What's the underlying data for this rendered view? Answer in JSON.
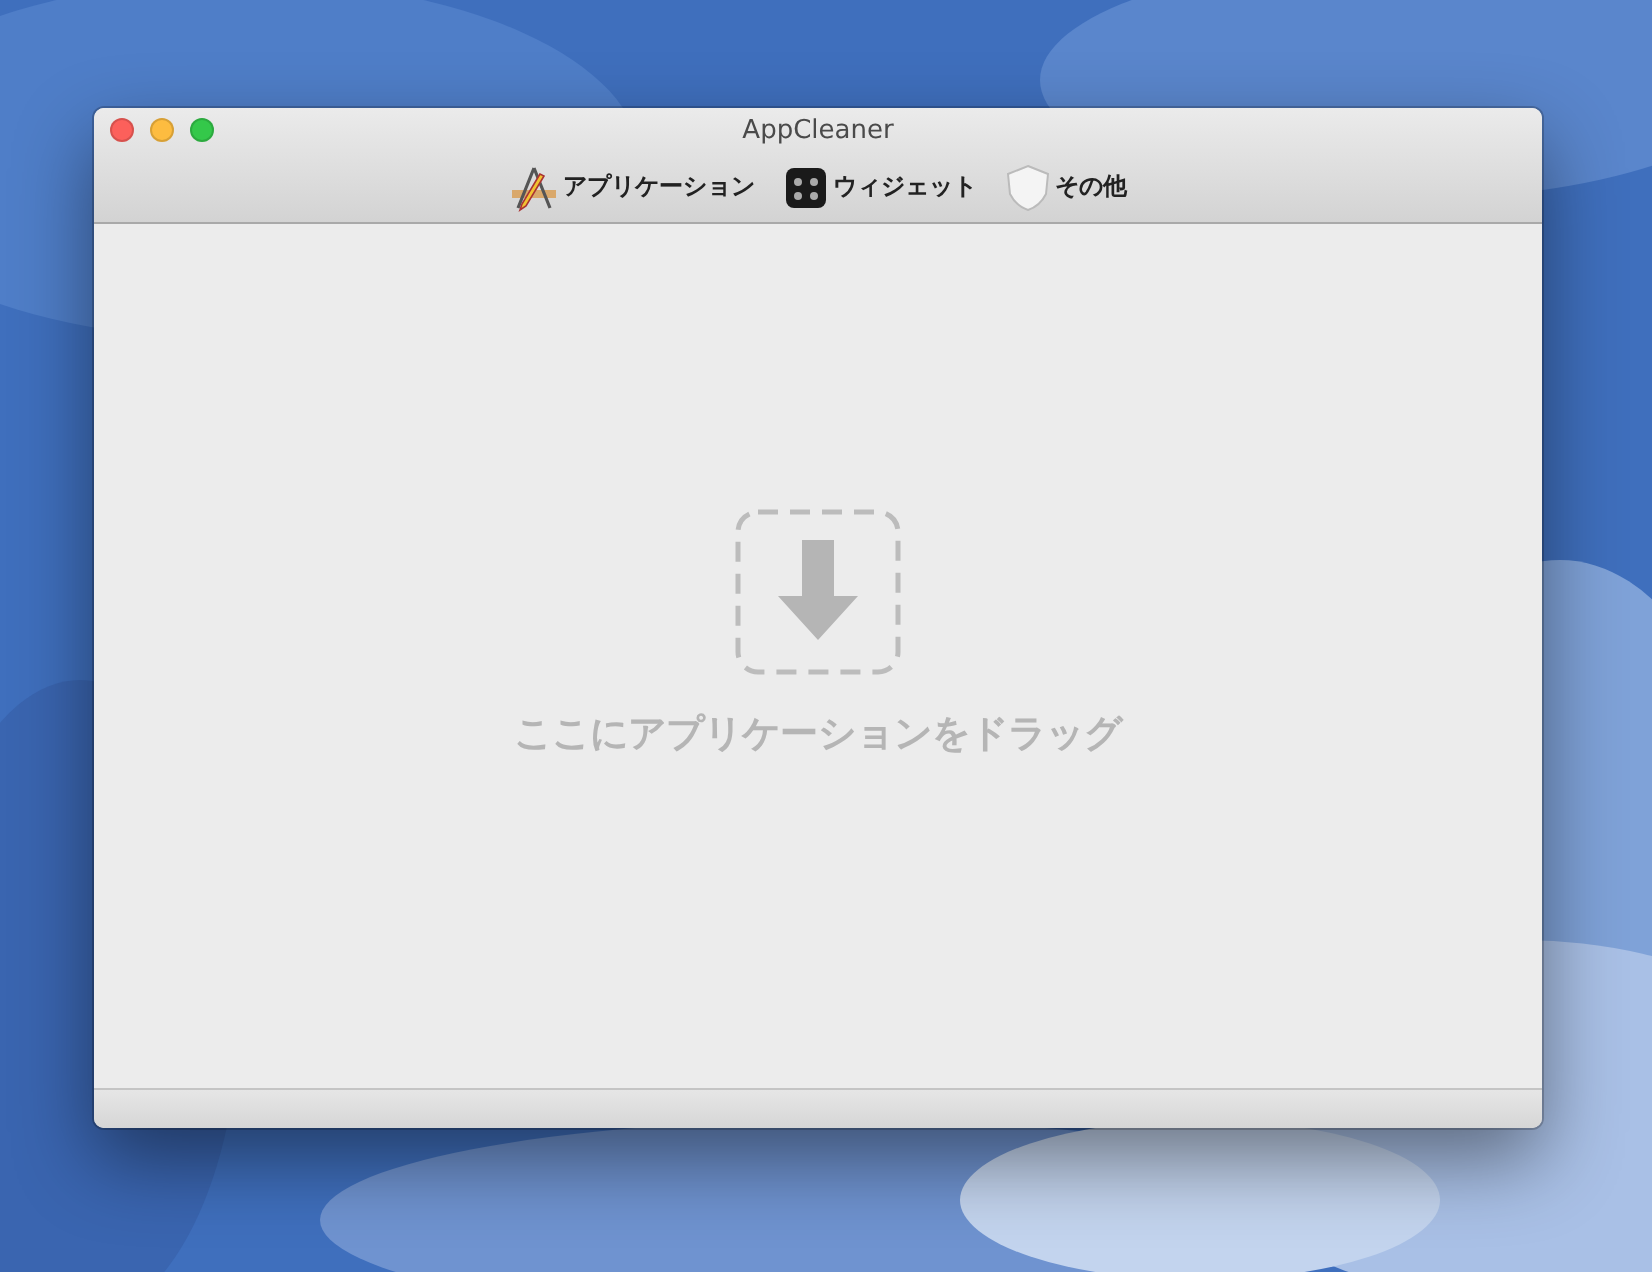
{
  "window": {
    "title": "AppCleaner"
  },
  "toolbar": {
    "items": [
      {
        "kind": "applications",
        "label": "アプリケーション"
      },
      {
        "kind": "widgets",
        "label": "ウィジェット"
      },
      {
        "kind": "other",
        "label": "その他"
      }
    ]
  },
  "drop_zone": {
    "hint": "ここにアプリケーションをドラッグ"
  }
}
